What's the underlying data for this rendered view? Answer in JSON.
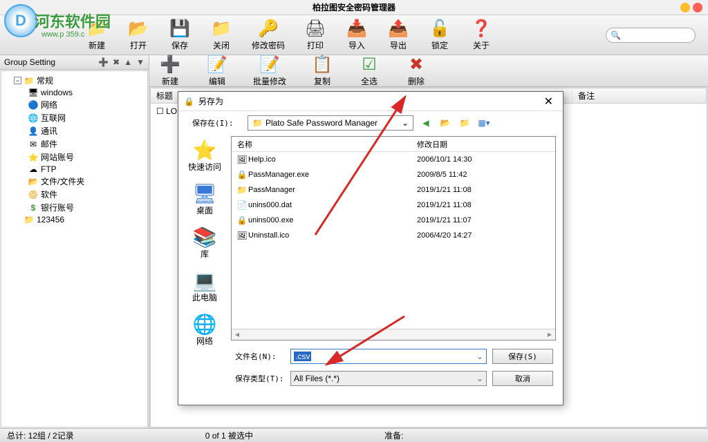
{
  "window": {
    "title": "柏拉图安全密码管理器"
  },
  "logo": {
    "text": "河东软件园",
    "sub": "www.p 359.c"
  },
  "toolbar": [
    {
      "icon": "📁",
      "label": "新建",
      "name": "new-button",
      "cls": "ic-folder"
    },
    {
      "icon": "📂",
      "label": "打开",
      "name": "open-button",
      "cls": "ic-folder"
    },
    {
      "icon": "💾",
      "label": "保存",
      "name": "save-button",
      "cls": "ic-save"
    },
    {
      "icon": "📁",
      "label": "关闭",
      "name": "close-button",
      "cls": "ic-folder"
    },
    {
      "icon": "🔑",
      "label": "修改密码",
      "name": "change-password-button",
      "cls": "ic-key"
    },
    {
      "icon": "🖨",
      "label": "打印",
      "name": "print-button",
      "cls": "ic-print"
    },
    {
      "icon": "📥",
      "label": "导入",
      "name": "import-button",
      "cls": "ic-import"
    },
    {
      "icon": "📤",
      "label": "导出",
      "name": "export-button",
      "cls": "ic-export"
    },
    {
      "icon": "🔓",
      "label": "锁定",
      "name": "lock-button",
      "cls": "ic-lock"
    },
    {
      "icon": "❓",
      "label": "关于",
      "name": "about-button",
      "cls": "ic-about"
    }
  ],
  "subtoolbar": [
    {
      "icon": "➕",
      "label": "新建",
      "name": "sub-new-button",
      "cls": "ic-new"
    },
    {
      "icon": "📝",
      "label": "编辑",
      "name": "sub-edit-button",
      "cls": "ic-edit"
    },
    {
      "icon": "📝",
      "label": "批量修改",
      "name": "sub-batch-button",
      "cls": "ic-edit"
    },
    {
      "icon": "📋",
      "label": "复制",
      "name": "sub-copy-button",
      "cls": "ic-copy"
    },
    {
      "icon": "☑",
      "label": "全选",
      "name": "sub-selectall-button",
      "cls": "ic-check"
    },
    {
      "icon": "✖",
      "label": "删除",
      "name": "sub-delete-button",
      "cls": "ic-del"
    }
  ],
  "sidepanel": {
    "title": "Group Setting",
    "tree": {
      "root": "常规",
      "children": [
        {
          "icon": "🖥",
          "label": "windows",
          "name": "tree-windows"
        },
        {
          "icon": "🔵",
          "label": "网络",
          "name": "tree-network"
        },
        {
          "icon": "🌐",
          "label": "互联网",
          "name": "tree-internet"
        },
        {
          "icon": "👤",
          "label": "通讯",
          "name": "tree-comm"
        },
        {
          "icon": "✉",
          "label": "邮件",
          "name": "tree-mail"
        },
        {
          "icon": "⭐",
          "label": "网站账号",
          "name": "tree-web-account"
        },
        {
          "icon": "☁",
          "label": "FTP",
          "name": "tree-ftp"
        },
        {
          "icon": "📂",
          "label": "文件/文件夹",
          "name": "tree-files"
        },
        {
          "icon": "📀",
          "label": "软件",
          "name": "tree-software"
        },
        {
          "icon": "$",
          "label": "银行账号",
          "name": "tree-bank",
          "iconColor": "#3a9b3a"
        }
      ],
      "extra": {
        "icon": "📁",
        "label": "123456",
        "name": "tree-123456"
      }
    }
  },
  "columns": {
    "title": "标题",
    "note": "备注"
  },
  "list_item": "LOL",
  "status": {
    "left": "总计: 12组 / 2记录",
    "mid": "0 of 1 被选中",
    "right": "准备:"
  },
  "dialog": {
    "title": "另存为",
    "location_label": "保存在(I):",
    "location_value": "Plato Safe Password Manager",
    "sidebar": [
      {
        "icon": "⭐",
        "label": "快速访问",
        "name": "dlg-quick-access",
        "color": "#3878d8"
      },
      {
        "icon": "🖥",
        "label": "桌面",
        "name": "dlg-desktop",
        "color": "#3878d8"
      },
      {
        "icon": "📚",
        "label": "库",
        "name": "dlg-library",
        "color": "#3878d8"
      },
      {
        "icon": "💻",
        "label": "此电脑",
        "name": "dlg-thispc",
        "color": "#3878d8"
      },
      {
        "icon": "🌐",
        "label": "网络",
        "name": "dlg-network",
        "color": "#3878d8"
      }
    ],
    "file_headers": {
      "name": "名称",
      "date": "修改日期"
    },
    "files": [
      {
        "icon": "🖼",
        "name": "Help.ico",
        "date": "2006/10/1 14:30"
      },
      {
        "icon": "🔒",
        "name": "PassManager.exe",
        "date": "2009/8/5 11:42"
      },
      {
        "icon": "📁",
        "name": "PassManager",
        "date": "2019/1/21 11:08"
      },
      {
        "icon": "📄",
        "name": "unins000.dat",
        "date": "2019/1/21 11:08"
      },
      {
        "icon": "🔒",
        "name": "unins000.exe",
        "date": "2019/1/21 11:07"
      },
      {
        "icon": "🖼",
        "name": "Uninstall.ico",
        "date": "2006/4/20 14:27"
      }
    ],
    "filename_label": "文件名(N):",
    "filename_value": ".csv",
    "filetype_label": "保存类型(T):",
    "filetype_value": "All Files (*.*)",
    "save_btn": "保存(S)",
    "cancel_btn": "取消"
  }
}
